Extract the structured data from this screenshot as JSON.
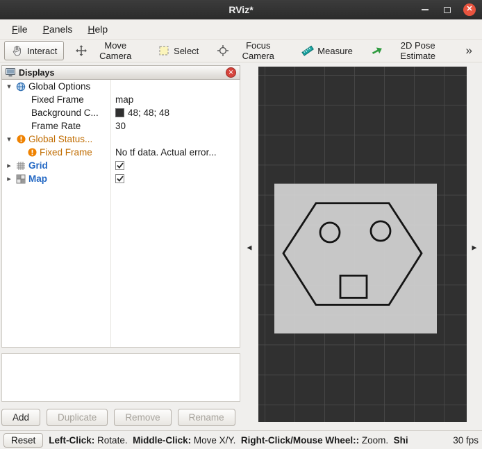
{
  "window": {
    "title": "RViz*"
  },
  "icons": {
    "expander_open": "▾",
    "expander_closed": "▸",
    "overflow": "»",
    "collapse_left": "◀",
    "collapse_right": "▶",
    "close": "✕"
  },
  "menubar": {
    "file": {
      "mn": "F",
      "rest": "ile"
    },
    "panels": {
      "mn": "P",
      "rest": "anels"
    },
    "help": {
      "mn": "H",
      "rest": "elp"
    }
  },
  "toolbar": {
    "interact": "Interact",
    "move_camera": "Move Camera",
    "select": "Select",
    "focus_camera": "Focus Camera",
    "measure": "Measure",
    "pose_estimate": "2D Pose Estimate"
  },
  "displays": {
    "title": "Displays",
    "tree": {
      "global_options": {
        "label": "Global Options"
      },
      "fixed_frame": {
        "label": "Fixed Frame",
        "value": "map"
      },
      "background_color": {
        "label": "Background C...",
        "value": "48; 48; 48",
        "swatch": "#303030"
      },
      "frame_rate": {
        "label": "Frame Rate",
        "value": "30"
      },
      "global_status": {
        "label": "Global Status..."
      },
      "status_fixed_frame": {
        "label": "Fixed Frame",
        "value": "No tf data.  Actual error..."
      },
      "grid": {
        "label": "Grid",
        "checked": true
      },
      "map": {
        "label": "Map",
        "checked": true
      }
    },
    "buttons": {
      "add": "Add",
      "duplicate": "Duplicate",
      "remove": "Remove",
      "rename": "Rename"
    }
  },
  "statusbar": {
    "reset": "Reset",
    "segments": [
      {
        "text": "Left-Click:"
      },
      {
        "text": " Rotate.  "
      },
      {
        "text": "Middle-Click:"
      },
      {
        "text": " Move X/Y.  "
      },
      {
        "text": "Right-Click/Mouse Wheel::"
      },
      {
        "text": " Zoom.  "
      },
      {
        "text": "Shi"
      }
    ],
    "fps": "30 fps"
  },
  "colors": {
    "viewport_background": "#303030",
    "viewport_grid": "#4e4e4e",
    "map_fill": "#d3d3d3",
    "map_outline": "#141414",
    "display_name_blue": "#2368c4",
    "warning_orange": "#c06c00",
    "warning_icon": "#ef8200",
    "panel_close_red": "#d6443c",
    "titlebar_close_orange": "#e9543f"
  }
}
